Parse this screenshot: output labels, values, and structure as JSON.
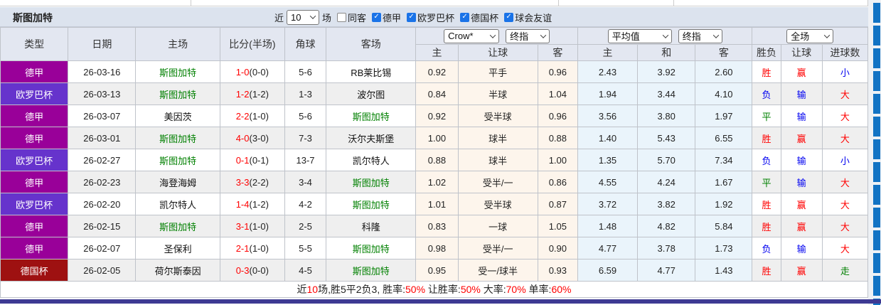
{
  "title": "斯图加特",
  "filters": {
    "near_label": "近",
    "matches_select": "10",
    "matches_label": "场",
    "checkboxes": [
      {
        "label": "同客",
        "checked": false
      },
      {
        "label": "德甲",
        "checked": true
      },
      {
        "label": "欧罗巴杯",
        "checked": true
      },
      {
        "label": "德国杯",
        "checked": true
      },
      {
        "label": "球会友谊",
        "checked": true
      }
    ]
  },
  "header": {
    "col_type": "类型",
    "col_date": "日期",
    "col_home": "主场",
    "col_score": "比分(半场)",
    "col_corner": "角球",
    "col_away": "客场",
    "handicap_company_select": "Crow*",
    "handicap_index_select": "终指",
    "euro_company_select": "平均值",
    "euro_index_select": "终指",
    "scope_select": "全场",
    "handicap_cols": [
      "主",
      "让球",
      "客"
    ],
    "euro_cols": [
      "主",
      "和",
      "客"
    ],
    "result_cols": [
      "胜负",
      "让球",
      "进球数"
    ]
  },
  "colors": {
    "leagues": {
      "德甲": "#990099",
      "欧罗巴杯": "#6633cc",
      "德国杯": "#9e1111"
    },
    "focus_team": "#008000",
    "win": "#f00000",
    "lose": "#0000f0",
    "draw": "#008000",
    "score_red": "#ff0000",
    "handicap_bg": "#fdf5ec",
    "euro_bg": "#eaf4fb",
    "title_bar_bg": "#dce3ee",
    "header_bg": "#e3e7f1",
    "right_strip_blue": "#1273c4",
    "bottom_bar": "#3e3a93"
  },
  "rows": [
    {
      "league": "德甲",
      "date": "26-03-16",
      "home": "斯图加特",
      "home_hl": true,
      "score": "1-0",
      "half": "(0-0)",
      "corner": "5-6",
      "away": "RB莱比锡",
      "away_hl": false,
      "hcp": [
        "0.92",
        "平手",
        "0.96"
      ],
      "euro": [
        "2.43",
        "3.92",
        "2.60"
      ],
      "result": [
        "胜",
        "赢",
        "小"
      ],
      "result_colors": [
        "red",
        "red",
        "blue"
      ]
    },
    {
      "league": "欧罗巴杯",
      "date": "26-03-13",
      "home": "斯图加特",
      "home_hl": true,
      "score": "1-2",
      "half": "(1-2)",
      "corner": "1-3",
      "away": "波尔图",
      "away_hl": false,
      "hcp": [
        "0.84",
        "半球",
        "1.04"
      ],
      "euro": [
        "1.94",
        "3.44",
        "4.10"
      ],
      "result": [
        "负",
        "输",
        "大"
      ],
      "result_colors": [
        "blue",
        "blue",
        "red"
      ]
    },
    {
      "league": "德甲",
      "date": "26-03-07",
      "home": "美因茨",
      "home_hl": false,
      "score": "2-2",
      "half": "(1-0)",
      "corner": "5-6",
      "away": "斯图加特",
      "away_hl": true,
      "hcp": [
        "0.92",
        "受半球",
        "0.96"
      ],
      "euro": [
        "3.56",
        "3.80",
        "1.97"
      ],
      "result": [
        "平",
        "输",
        "大"
      ],
      "result_colors": [
        "green",
        "blue",
        "red"
      ]
    },
    {
      "league": "德甲",
      "date": "26-03-01",
      "home": "斯图加特",
      "home_hl": true,
      "score": "4-0",
      "half": "(3-0)",
      "corner": "7-3",
      "away": "沃尔夫斯堡",
      "away_hl": false,
      "hcp": [
        "1.00",
        "球半",
        "0.88"
      ],
      "euro": [
        "1.40",
        "5.43",
        "6.55"
      ],
      "result": [
        "胜",
        "赢",
        "大"
      ],
      "result_colors": [
        "red",
        "red",
        "red"
      ]
    },
    {
      "league": "欧罗巴杯",
      "date": "26-02-27",
      "home": "斯图加特",
      "home_hl": true,
      "score": "0-1",
      "half": "(0-1)",
      "corner": "13-7",
      "away": "凯尔特人",
      "away_hl": false,
      "hcp": [
        "0.88",
        "球半",
        "1.00"
      ],
      "euro": [
        "1.35",
        "5.70",
        "7.34"
      ],
      "result": [
        "负",
        "输",
        "小"
      ],
      "result_colors": [
        "blue",
        "blue",
        "blue"
      ]
    },
    {
      "league": "德甲",
      "date": "26-02-23",
      "home": "海登海姆",
      "home_hl": false,
      "score": "3-3",
      "half": "(2-2)",
      "corner": "3-4",
      "away": "斯图加特",
      "away_hl": true,
      "hcp": [
        "1.02",
        "受半/一",
        "0.86"
      ],
      "euro": [
        "4.55",
        "4.24",
        "1.67"
      ],
      "result": [
        "平",
        "输",
        "大"
      ],
      "result_colors": [
        "green",
        "blue",
        "red"
      ]
    },
    {
      "league": "欧罗巴杯",
      "date": "26-02-20",
      "home": "凯尔特人",
      "home_hl": false,
      "score": "1-4",
      "half": "(1-2)",
      "corner": "4-2",
      "away": "斯图加特",
      "away_hl": true,
      "hcp": [
        "1.01",
        "受半球",
        "0.87"
      ],
      "euro": [
        "3.72",
        "3.82",
        "1.92"
      ],
      "result": [
        "胜",
        "赢",
        "大"
      ],
      "result_colors": [
        "red",
        "red",
        "red"
      ]
    },
    {
      "league": "德甲",
      "date": "26-02-15",
      "home": "斯图加特",
      "home_hl": true,
      "score": "3-1",
      "half": "(1-0)",
      "corner": "2-5",
      "away": "科隆",
      "away_hl": false,
      "hcp": [
        "0.83",
        "一球",
        "1.05"
      ],
      "euro": [
        "1.48",
        "4.82",
        "5.84"
      ],
      "result": [
        "胜",
        "赢",
        "大"
      ],
      "result_colors": [
        "red",
        "red",
        "red"
      ]
    },
    {
      "league": "德甲",
      "date": "26-02-07",
      "home": "圣保利",
      "home_hl": false,
      "score": "2-1",
      "half": "(1-0)",
      "corner": "5-5",
      "away": "斯图加特",
      "away_hl": true,
      "hcp": [
        "0.98",
        "受半/一",
        "0.90"
      ],
      "euro": [
        "4.77",
        "3.78",
        "1.73"
      ],
      "result": [
        "负",
        "输",
        "大"
      ],
      "result_colors": [
        "blue",
        "blue",
        "red"
      ]
    },
    {
      "league": "德国杯",
      "date": "26-02-05",
      "home": "荷尔斯泰因",
      "home_hl": false,
      "score": "0-3",
      "half": "(0-0)",
      "corner": "4-5",
      "away": "斯图加特",
      "away_hl": true,
      "hcp": [
        "0.95",
        "受一/球半",
        "0.93"
      ],
      "euro": [
        "6.59",
        "4.77",
        "1.43"
      ],
      "result": [
        "胜",
        "赢",
        "走"
      ],
      "result_colors": [
        "red",
        "red",
        "green"
      ]
    }
  ],
  "footer_segments": [
    {
      "text": "近",
      "color": "dark"
    },
    {
      "text": "10",
      "color": "red"
    },
    {
      "text": "场,胜5平2负3, 胜率:",
      "color": "dark"
    },
    {
      "text": "50%",
      "color": "red"
    },
    {
      "text": " 让胜率:",
      "color": "dark"
    },
    {
      "text": "50%",
      "color": "red"
    },
    {
      "text": " 大率:",
      "color": "dark"
    },
    {
      "text": "70%",
      "color": "red"
    },
    {
      "text": " 单率:",
      "color": "dark"
    },
    {
      "text": "60%",
      "color": "red"
    }
  ]
}
